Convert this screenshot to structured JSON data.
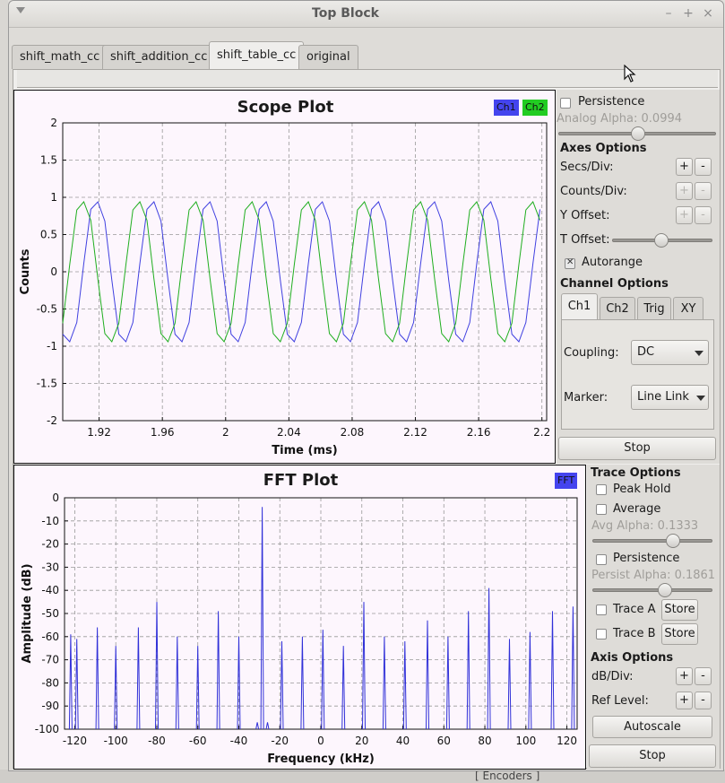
{
  "window": {
    "title": "Top Block"
  },
  "tabs": [
    {
      "label": "shift_math_cc"
    },
    {
      "label": "shift_addition_cc"
    },
    {
      "label": "shift_table_cc"
    },
    {
      "label": "original"
    }
  ],
  "active_tab": "shift_table_cc",
  "background": {
    "bottom_text": "[ Encoders ]"
  },
  "scope": {
    "title": "Scope Plot",
    "legend": [
      {
        "label": "Ch1",
        "color": "#4444ee"
      },
      {
        "label": "Ch2",
        "color": "#22cc22"
      }
    ],
    "controls": {
      "persistence_label": "Persistence",
      "persistence_checked": false,
      "analog_alpha_label": "Analog Alpha: 0.0994",
      "analog_alpha_value": 0.0994,
      "axes_options_label": "Axes Options",
      "secs_div_label": "Secs/Div:",
      "counts_div_label": "Counts/Div:",
      "y_offset_label": "Y Offset:",
      "t_offset_label": "T Offset:",
      "t_offset_level": 0.6,
      "autorange_label": "Autorange",
      "autorange_checked": true,
      "channel_options_label": "Channel Options",
      "channel_tabs": [
        "Ch1",
        "Ch2",
        "Trig",
        "XY"
      ],
      "active_channel_tab": "Ch1",
      "coupling_label": "Coupling:",
      "coupling_value": "DC",
      "marker_label": "Marker:",
      "marker_value": "Line Link",
      "stop_label": "Stop",
      "plus": "+",
      "minus": "-"
    }
  },
  "fft": {
    "title": "FFT Plot",
    "legend": [
      {
        "label": "FFT",
        "color": "#4444ee"
      }
    ],
    "controls": {
      "trace_options_label": "Trace Options",
      "peak_hold_label": "Peak Hold",
      "average_label": "Average",
      "avg_alpha_label": "Avg Alpha: 0.1333",
      "avg_alpha_value": 0.1333,
      "persistence_label": "Persistence",
      "persist_alpha_label": "Persist Alpha: 0.1861",
      "persist_alpha_value": 0.1861,
      "trace_a_label": "Trace A",
      "trace_b_label": "Trace B",
      "store_label": "Store",
      "axis_options_label": "Axis Options",
      "db_div_label": "dB/Div:",
      "ref_level_label": "Ref Level:",
      "autoscale_label": "Autoscale",
      "stop_label": "Stop",
      "plus": "+",
      "minus": "-"
    }
  },
  "chart_data": [
    {
      "type": "line",
      "title": "Scope Plot",
      "xlabel": "Time (ms)",
      "ylabel": "Counts",
      "xlim": [
        1.897,
        2.203
      ],
      "ylim": [
        -2,
        2
      ],
      "xticks": [
        1.92,
        1.96,
        2,
        2.04,
        2.08,
        2.12,
        2.16,
        2.2
      ],
      "xtick_labels": [
        "1.92",
        "1.96",
        "2",
        "2.04",
        "2.08",
        "2.12",
        "2.16",
        "2.2"
      ],
      "yticks": [
        -2,
        -1.5,
        -1,
        -0.5,
        0,
        0.5,
        1,
        1.5,
        2
      ],
      "ytick_labels": [
        "-2",
        "-1.5",
        "-1",
        "-0.5",
        "0",
        "0.5",
        "1",
        "1.5",
        "2"
      ],
      "grid": true,
      "legend": "top-right",
      "series": [
        {
          "name": "Ch1",
          "color": "#4040e0",
          "kind": "sinusoid",
          "amplitude": 1,
          "period_ms": 0.0355,
          "peak_at_ms": 1.9186
        },
        {
          "name": "Ch2",
          "color": "#1fae1f",
          "kind": "sinusoid",
          "amplitude": 1,
          "period_ms": 0.0355,
          "peak_at_ms": 1.9098
        }
      ]
    },
    {
      "type": "line",
      "title": "FFT Plot",
      "xlabel": "Frequency (kHz)",
      "ylabel": "Amplitude (dB)",
      "xlim": [
        -125,
        125
      ],
      "ylim": [
        -100,
        0
      ],
      "xticks": [
        -120,
        -100,
        -80,
        -60,
        -40,
        -20,
        0,
        20,
        40,
        60,
        80,
        100,
        120
      ],
      "xtick_labels": [
        "-120",
        "-100",
        "-80",
        "-60",
        "-40",
        "-20",
        "0",
        "20",
        "40",
        "60",
        "80",
        "100",
        "120"
      ],
      "yticks": [
        0,
        -10,
        -20,
        -30,
        -40,
        -50,
        -60,
        -70,
        -80,
        -90,
        -100
      ],
      "ytick_labels": [
        "0",
        "-10",
        "-20",
        "-30",
        "-40",
        "-50",
        "-60",
        "-70",
        "-80",
        "-90",
        "-100"
      ],
      "grid": true,
      "legend": "top-right",
      "series": [
        {
          "name": "FFT",
          "color": "#3030d8",
          "peaks": [
            {
              "f": -122,
              "db": -59
            },
            {
              "f": -119,
              "db": -61
            },
            {
              "f": -109,
              "db": -56
            },
            {
              "f": -100,
              "db": -64
            },
            {
              "f": -89,
              "db": -56
            },
            {
              "f": -80,
              "db": -45
            },
            {
              "f": -70,
              "db": -60
            },
            {
              "f": -60,
              "db": -64
            },
            {
              "f": -50,
              "db": -49
            },
            {
              "f": -40,
              "db": -60
            },
            {
              "f": -31,
              "db": -97
            },
            {
              "f": -28.6,
              "db": -4
            },
            {
              "f": -26,
              "db": -97
            },
            {
              "f": -19,
              "db": -62
            },
            {
              "f": -9,
              "db": -60
            },
            {
              "f": 1,
              "db": -57
            },
            {
              "f": 11,
              "db": -64
            },
            {
              "f": 21,
              "db": -45
            },
            {
              "f": 31,
              "db": -60
            },
            {
              "f": 41,
              "db": -62
            },
            {
              "f": 52,
              "db": -53
            },
            {
              "f": 62,
              "db": -60
            },
            {
              "f": 72,
              "db": -49
            },
            {
              "f": 82,
              "db": -39
            },
            {
              "f": 92,
              "db": -61
            },
            {
              "f": 102,
              "db": -58
            },
            {
              "f": 113,
              "db": -49
            },
            {
              "f": 123,
              "db": -47
            }
          ],
          "floor_db": -100
        }
      ]
    }
  ]
}
